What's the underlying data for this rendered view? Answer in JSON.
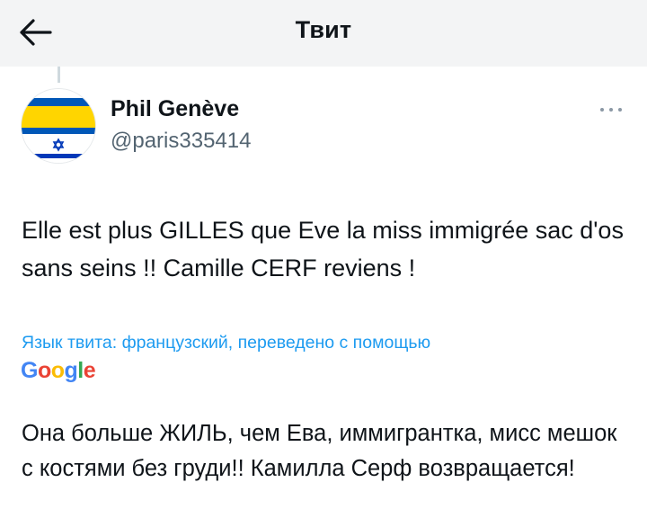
{
  "header": {
    "title": "Твит"
  },
  "author": {
    "name": "Phil Genève",
    "handle": "@paris335414"
  },
  "tweet": {
    "text": "Elle est plus GILLES que Eve la miss immigrée sac d'os sans seins !! Camille CERF reviens !"
  },
  "translation": {
    "label": "Язык твита: французский, переведено с помощью",
    "provider": "Google",
    "text": "Она больше ЖИЛЬ, чем Ева, иммигрантка, мисс мешок с костями без груди!! Камилла Серф возвращается!"
  },
  "colors": {
    "accent": "#1d9bf0",
    "secondary_text": "#536471",
    "header_bg": "#f3f4f5",
    "flag_yellow": "#ffd500",
    "flag_blue": "#0057b7",
    "star_blue": "#0038b8"
  },
  "icons": {
    "back": "arrow-left-icon",
    "more": "more-dots-icon",
    "star": "star-of-david-icon"
  }
}
